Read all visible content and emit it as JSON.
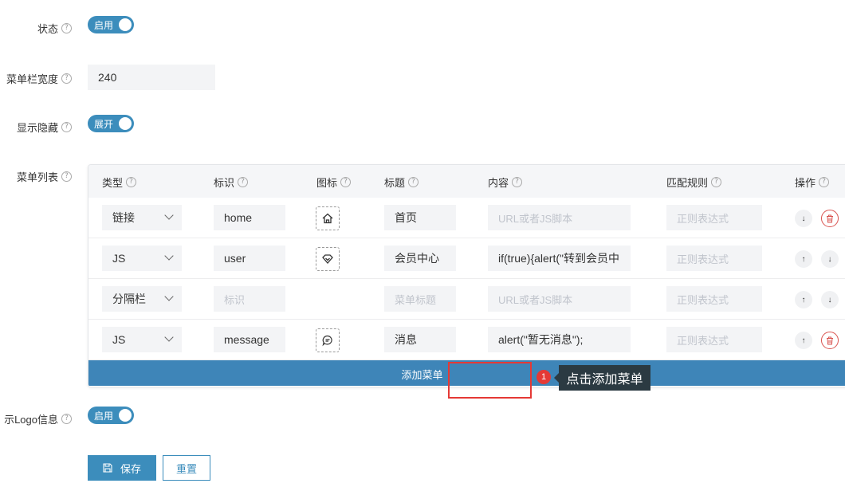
{
  "form": {
    "status": {
      "label": "状态",
      "toggle": "启用"
    },
    "width": {
      "label": "菜单栏宽度",
      "value": "240"
    },
    "display": {
      "label": "显示隐藏",
      "toggle": "展开"
    },
    "menu_list": {
      "label": "菜单列表"
    },
    "logo": {
      "label": "示Logo信息",
      "toggle": "启用"
    }
  },
  "table": {
    "headers": [
      "类型",
      "标识",
      "图标",
      "标题",
      "内容",
      "匹配规则",
      "操作"
    ],
    "rows": [
      {
        "type": "链接",
        "key": "home",
        "icon": "home-icon",
        "title": "首页",
        "content": "",
        "content_placeholder": "URL或者JS脚本",
        "rule_placeholder": "正则表达式"
      },
      {
        "type": "JS",
        "key": "user",
        "icon": "diamond-icon",
        "title": "会员中心",
        "content": "if(true){alert(\"转到会员中",
        "content_placeholder": "",
        "rule_placeholder": "正则表达式"
      },
      {
        "type": "分隔栏",
        "key": "",
        "key_placeholder": "标识",
        "icon": "",
        "title": "",
        "title_placeholder": "菜单标题",
        "content": "",
        "content_placeholder": "URL或者JS脚本",
        "rule_placeholder": "正则表达式"
      },
      {
        "type": "JS",
        "key": "message",
        "icon": "message-icon",
        "title": "消息",
        "content": "alert(\"暂无消息\");",
        "content_placeholder": "",
        "rule_placeholder": "正则表达式"
      }
    ],
    "add_label": "添加菜单"
  },
  "guide": {
    "step": "1",
    "tip": "点击添加菜单"
  },
  "buttons": {
    "save": "保存",
    "reset": "重置"
  },
  "colors": {
    "primary": "#3c8dbc",
    "highlight": "#e53935",
    "tooltip_bg": "#2b3a42"
  }
}
